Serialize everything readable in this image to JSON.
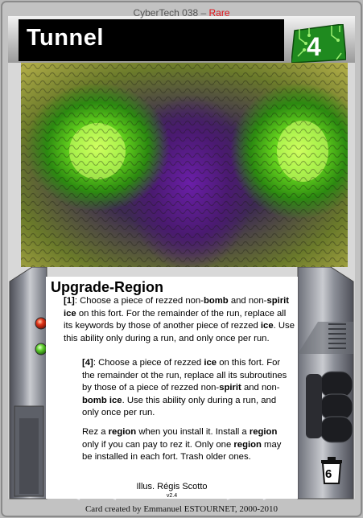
{
  "card": {
    "set_name": "CyberTech 038",
    "set_separator": " – ",
    "rarity": "Rare",
    "title": "Tunnel",
    "cost": "4",
    "subtype": "Upgrade-Region",
    "trash_cost": "6",
    "illustrator": "Illus. Régis Scotto",
    "version": "v2.4",
    "credit": "Card created by Emmanuel ESTOURNET, 2000-2010"
  },
  "abilities": [
    {
      "cost": "[1]",
      "segments": [
        [
          "[1]",
          true
        ],
        [
          ": Choose a piece of rezzed non-",
          false
        ],
        [
          "bomb",
          true
        ],
        [
          " and non-",
          false
        ],
        [
          "spirit ice",
          true
        ],
        [
          " on this fort. For the remainder of the run, replace all its keywords by those of another piece of rezzed ",
          false
        ],
        [
          "ice",
          true
        ],
        [
          ". Use this ability only during a run, and only once per run.",
          false
        ]
      ]
    },
    {
      "cost": "[4]",
      "segments": [
        [
          "[4]",
          true
        ],
        [
          ": Choose a piece of rezzed ",
          false
        ],
        [
          "ice",
          true
        ],
        [
          " on this fort. For the remainder ot the run, replace all its subroutines by those of a piece of rezzed non-",
          false
        ],
        [
          "spirit",
          true
        ],
        [
          " and non-",
          false
        ],
        [
          "bomb ice",
          true
        ],
        [
          ". Use this ability only during a  run, and only once per run.",
          false
        ]
      ]
    },
    {
      "cost": "",
      "segments": [
        [
          "Rez a ",
          false
        ],
        [
          "region",
          true
        ],
        [
          " when you install it. Install a ",
          false
        ],
        [
          "region",
          true
        ],
        [
          " only if you can pay to rez it. Only one ",
          false
        ],
        [
          "region",
          true
        ],
        [
          " may be installed in each fort. Trash older ones.",
          false
        ]
      ]
    }
  ],
  "colors": {
    "frame": "#b9b9b9",
    "title_bar": "#000000",
    "cost_badge": "#1f8a1f",
    "rarity": "#e2141c",
    "led_red": "#e03418",
    "led_green": "#5fd12e",
    "meter_orange": "#e8701c"
  },
  "icons": [
    "cost-chip-icon",
    "trash-can-icon",
    "red-led-icon",
    "green-led-icon"
  ]
}
